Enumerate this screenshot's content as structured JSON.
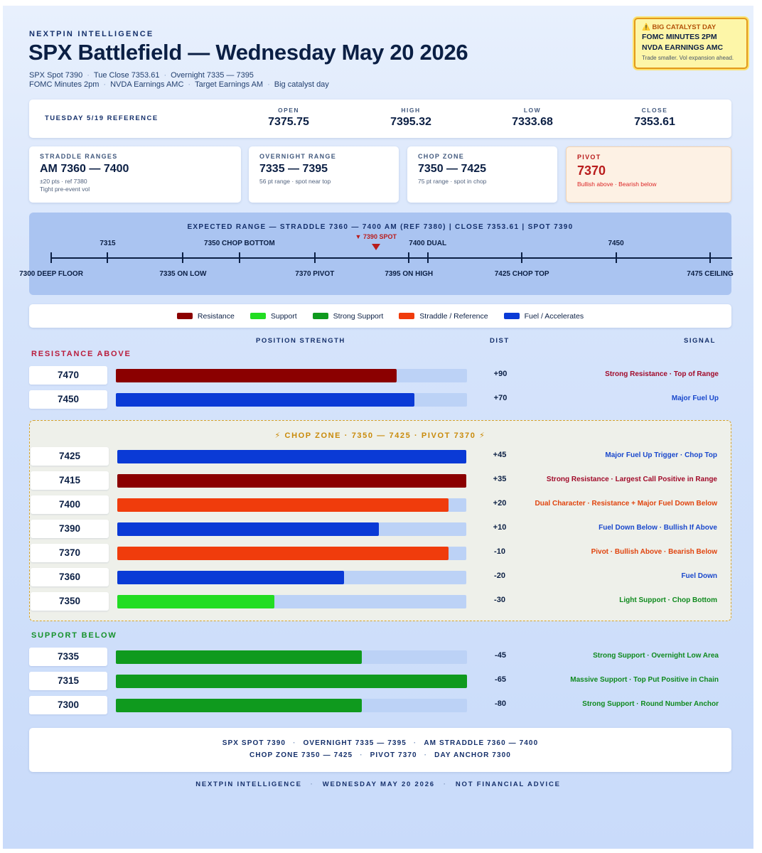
{
  "header": {
    "brand": "NEXTPIN INTELLIGENCE",
    "title": "SPX Battlefield — Wednesday May 20 2026",
    "sub1": [
      "SPX Spot 7390",
      "Tue Close 7353.61",
      "Overnight 7335 — 7395"
    ],
    "sub2": [
      "FOMC Minutes 2pm",
      "NVDA Earnings AMC",
      "Target Earnings AM",
      "Big catalyst day"
    ]
  },
  "catalyst": {
    "icon": "warning-icon",
    "heading": "BIG CATALYST DAY",
    "line1": "FOMC MINUTES 2PM",
    "line2": "NVDA EARNINGS AMC",
    "note": "Trade smaller. Vol expansion ahead."
  },
  "reference": {
    "label": "TUESDAY 5/19 REFERENCE",
    "items": [
      {
        "key": "OPEN",
        "value": "7375.75"
      },
      {
        "key": "HIGH",
        "value": "7395.32"
      },
      {
        "key": "LOW",
        "value": "7333.68"
      },
      {
        "key": "CLOSE",
        "value": "7353.61"
      }
    ]
  },
  "stats": [
    {
      "key": "STRADDLE RANGES",
      "value": "AM 7360 — 7400",
      "note1": "±20 pts · ref 7380",
      "note2": "Tight pre-event vol"
    },
    {
      "key": "OVERNIGHT RANGE",
      "value": "7335 — 7395",
      "note1": "56 pt range · spot near top",
      "note2": ""
    },
    {
      "key": "CHOP ZONE",
      "value": "7350 — 7425",
      "note1": "75 pt range · spot in chop",
      "note2": ""
    },
    {
      "key": "PIVOT",
      "value": "7370",
      "note1": "Bullish above · Bearish below",
      "note2": ""
    }
  ],
  "expected_range": {
    "title": "EXPECTED RANGE — STRADDLE 7360 — 7400 AM (REF 7380) | CLOSE 7353.61 | SPOT 7390",
    "min": 7300,
    "max": 7475,
    "spot": {
      "value": 7390,
      "label": "▼ 7390 SPOT"
    },
    "ticks": [
      {
        "value": 7300,
        "label": "7300 DEEP FLOOR",
        "pos": "down"
      },
      {
        "value": 7315,
        "label": "7315",
        "pos": "up"
      },
      {
        "value": 7335,
        "label": "7335 ON LOW",
        "pos": "down"
      },
      {
        "value": 7350,
        "label": "7350 CHOP BOTTOM",
        "pos": "up"
      },
      {
        "value": 7370,
        "label": "7370 PIVOT",
        "pos": "down"
      },
      {
        "value": 7395,
        "label": "7395 ON HIGH",
        "pos": "down"
      },
      {
        "value": 7400,
        "label": "7400 DUAL",
        "pos": "up"
      },
      {
        "value": 7425,
        "label": "7425 CHOP TOP",
        "pos": "down"
      },
      {
        "value": 7450,
        "label": "7450",
        "pos": "up"
      },
      {
        "value": 7475,
        "label": "7475 CEILING",
        "pos": "down"
      }
    ]
  },
  "legend": [
    {
      "label": "Resistance",
      "color": "#8b0000"
    },
    {
      "label": "Support",
      "color": "#22dd22"
    },
    {
      "label": "Strong Support",
      "color": "#0f9a1e"
    },
    {
      "label": "Straddle / Reference",
      "color": "#f03c0c"
    },
    {
      "label": "Fuel / Accelerates",
      "color": "#0a3ad6"
    }
  ],
  "columns": {
    "strength": "POSITION STRENGTH",
    "dist": "DIST",
    "signal": "SIGNAL"
  },
  "sections": {
    "resistance": "RESISTANCE ABOVE",
    "chop": "⚡ CHOP ZONE · 7350 — 7425 · PIVOT 7370 ⚡",
    "support": "SUPPORT BELOW"
  },
  "colors": {
    "resistance": "#8b0000",
    "support": "#22dd22",
    "strong_support": "#0f9a1e",
    "straddle": "#f03c0c",
    "fuel": "#0a3ad6",
    "resistance_text": "#a10b2a",
    "fuel_text": "#1a48cc",
    "straddle_text": "#e0440e",
    "support_text": "#0f8a1e",
    "section_resistance": "#b91c3c",
    "section_support": "#15912a"
  },
  "levels": {
    "resistance": [
      {
        "level": "7470",
        "strength": 0.8,
        "kind": "resistance",
        "dist": "+90",
        "signal": "Strong Resistance · Top of Range"
      },
      {
        "level": "7450",
        "strength": 0.85,
        "kind": "fuel",
        "dist": "+70",
        "signal": "Major Fuel Up"
      }
    ],
    "chop": [
      {
        "level": "7425",
        "strength": 1.0,
        "kind": "fuel",
        "dist": "+45",
        "signal": "Major Fuel Up Trigger · Chop Top"
      },
      {
        "level": "7415",
        "strength": 1.0,
        "kind": "resistance",
        "dist": "+35",
        "signal": "Strong Resistance · Largest Call Positive in Range"
      },
      {
        "level": "7400",
        "strength": 0.95,
        "kind": "straddle",
        "dist": "+20",
        "signal": "Dual Character · Resistance + Major Fuel Down Below"
      },
      {
        "level": "7390",
        "strength": 0.75,
        "kind": "fuel",
        "dist": "+10",
        "signal": "Fuel Down Below · Bullish If Above"
      },
      {
        "level": "7370",
        "strength": 0.95,
        "kind": "straddle",
        "dist": "-10",
        "signal": "Pivot · Bullish Above · Bearish Below"
      },
      {
        "level": "7360",
        "strength": 0.65,
        "kind": "fuel",
        "dist": "-20",
        "signal": "Fuel Down"
      },
      {
        "level": "7350",
        "strength": 0.45,
        "kind": "support",
        "dist": "-30",
        "signal": "Light Support · Chop Bottom"
      }
    ],
    "support": [
      {
        "level": "7335",
        "strength": 0.7,
        "kind": "strong_support",
        "dist": "-45",
        "signal": "Strong Support · Overnight Low Area"
      },
      {
        "level": "7315",
        "strength": 1.0,
        "kind": "strong_support",
        "dist": "-65",
        "signal": "Massive Support · Top Put Positive in Chain"
      },
      {
        "level": "7300",
        "strength": 0.7,
        "kind": "strong_support",
        "dist": "-80",
        "signal": "Strong Support · Round Number Anchor"
      }
    ]
  },
  "summary": {
    "line1": [
      "SPX SPOT 7390",
      "OVERNIGHT 7335 — 7395",
      "AM STRADDLE 7360 — 7400"
    ],
    "line2": [
      "CHOP ZONE 7350 — 7425",
      "PIVOT 7370",
      "DAY ANCHOR 7300"
    ]
  },
  "footer": [
    "NEXTPIN INTELLIGENCE",
    "WEDNESDAY MAY 20 2026",
    "NOT FINANCIAL ADVICE"
  ]
}
